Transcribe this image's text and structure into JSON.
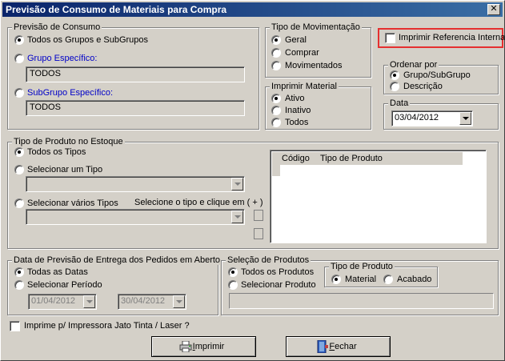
{
  "window": {
    "title": "Previsão de Consumo de Materiais para Compra",
    "close_glyph": "✕"
  },
  "previsao": {
    "legend": "Previsão de Consumo",
    "opt_todos": "Todos os Grupos e SubGrupos",
    "opt_grupo": "Grupo Específico:",
    "grupo_value": "TODOS",
    "opt_subgrupo": "SubGrupo Específico:",
    "subgrupo_value": "TODOS",
    "selected": "todos"
  },
  "movimentacao": {
    "legend": "Tipo de Movimentação",
    "opt_geral": "Geral",
    "opt_comprar": "Comprar",
    "opt_movimentados": "Movimentados",
    "selected": "geral"
  },
  "imprimir_material": {
    "legend": "Imprimir Material",
    "opt_ativo": "Ativo",
    "opt_inativo": "Inativo",
    "opt_todos": "Todos",
    "selected": "ativo"
  },
  "referencia": {
    "label": "Imprimir Referencia Interna",
    "checked": false
  },
  "ordenar": {
    "legend": "Ordenar por",
    "opt_grupo": "Grupo/SubGrupo",
    "opt_descricao": "Descrição",
    "selected": "grupo"
  },
  "data": {
    "legend": "Data",
    "value": "03/04/2012"
  },
  "tipo_produto_estoque": {
    "legend": "Tipo de Produto no Estoque",
    "opt_todos": "Todos os Tipos",
    "opt_um": "Selecionar um Tipo",
    "opt_varios": "Selecionar vários Tipos",
    "hint": "Selecione o tipo e clique em ( + )",
    "um_value": "",
    "varios_value": "",
    "selected": "todos",
    "list_headers": [
      "Código",
      "Tipo de Produto"
    ]
  },
  "entrega": {
    "legend": "Data de Previsão de Entrega dos Pedidos em Aberto",
    "opt_todas": "Todas as Datas",
    "opt_periodo": "Selecionar Período",
    "date_from": "01/04/2012",
    "date_to": "30/04/2012",
    "selected": "todas"
  },
  "selecao_produtos": {
    "legend": "Seleção de Produtos",
    "opt_todos": "Todos os Produtos",
    "opt_selecionar": "Selecionar Produto",
    "selected": "todos",
    "product_value": ""
  },
  "tipo_produto": {
    "legend": "Tipo de Produto",
    "opt_material": "Material",
    "opt_acabado": "Acabado",
    "selected": "material"
  },
  "jato_tinta": {
    "label": "Imprime p/ Impressora Jato Tinta / Laser ?",
    "checked": false
  },
  "buttons": {
    "imprimir_first": "I",
    "imprimir_rest": "mprimir",
    "fechar_first": "F",
    "fechar_rest": "echar"
  },
  "colors": {
    "titlebar_start": "#0a246a",
    "titlebar_end": "#3a6ea5",
    "highlight": "#e53030",
    "link_blue": "#0000c8"
  }
}
